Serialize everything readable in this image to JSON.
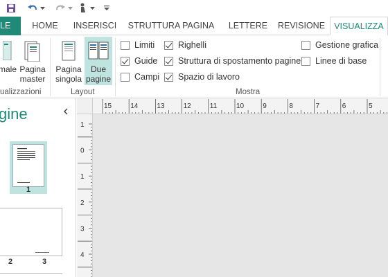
{
  "qat": {
    "icons": [
      "save-icon",
      "undo-icon",
      "undo-dropdown-icon",
      "redo-icon",
      "redo-dropdown-icon",
      "touch-mode-icon",
      "touch-dropdown-icon",
      "customize-qat-icon"
    ]
  },
  "tabs": {
    "file": "LE",
    "home": "HOME",
    "insert": "INSERISCI",
    "page_layout": "STRUTTURA PAGINA",
    "letters": "LETTERE",
    "review": "REVISIONE",
    "view": "VISUALIZZA",
    "active": "VISUALIZZA"
  },
  "ribbon": {
    "views_group": {
      "label": "ualizzazioni",
      "normal_label": "male",
      "master_label_line1": "Pagina",
      "master_label_line2": "master"
    },
    "layout_group": {
      "label": "Layout",
      "single_line1": "Pagina",
      "single_line2": "singola",
      "two_line1": "Due",
      "two_line2": "pagine",
      "two_pages_pressed": true
    },
    "show_group": {
      "label": "Mostra",
      "checkboxes": [
        {
          "label": "Limiti",
          "checked": false
        },
        {
          "label": "Guide",
          "checked": true
        },
        {
          "label": "Campi",
          "checked": false
        },
        {
          "label": "Righelli",
          "checked": true
        },
        {
          "label": "Struttura di spostamento pagine",
          "checked": true
        },
        {
          "label": "Spazio di lavoro",
          "checked": true
        },
        {
          "label": "Gestione grafica",
          "checked": false
        },
        {
          "label": "Linee di base",
          "checked": false
        }
      ]
    }
  },
  "nav_pane": {
    "title": "gine",
    "pages": [
      "1",
      "2",
      "3"
    ]
  },
  "rulers": {
    "horizontal_labels": [
      "15",
      "14",
      "13",
      "12",
      "11",
      "10",
      "9",
      "8",
      "7",
      "6",
      "5"
    ],
    "vertical_labels": [
      "1",
      "0",
      "1",
      "2",
      "3",
      "4"
    ]
  },
  "colors": {
    "accent": "#1f8a77",
    "pressed": "#bfe3de",
    "workspace": "#e6e6e6"
  }
}
